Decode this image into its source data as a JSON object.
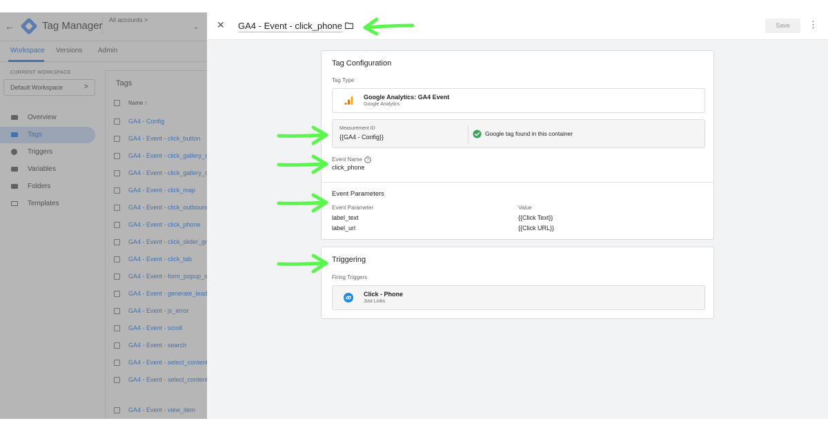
{
  "background_app": {
    "back_icon": "arrow-left-icon",
    "app_name": "Tag Manager",
    "accounts_label": "All accounts >",
    "accounts_caret": "⌄",
    "tabs": [
      "Workspace",
      "Versions",
      "Admin"
    ],
    "current_workspace_label": "CURRENT WORKSPACE",
    "workspace_name": "Default Workspace",
    "workspace_chevron": ">",
    "nav": [
      {
        "label": "Overview",
        "icon": "overview-icon",
        "active": false
      },
      {
        "label": "Tags",
        "icon": "tag-icon",
        "active": true
      },
      {
        "label": "Triggers",
        "icon": "trigger-icon",
        "active": false
      },
      {
        "label": "Variables",
        "icon": "variables-icon",
        "active": false
      },
      {
        "label": "Folders",
        "icon": "folder-icon",
        "active": false
      },
      {
        "label": "Templates",
        "icon": "template-icon",
        "active": false
      }
    ],
    "tags_table": {
      "title": "Tags",
      "column_name": "Name ↑",
      "rows": [
        "GA4 - Config",
        "GA4 - Event - click_button",
        "GA4 - Event - click_gallery_c",
        "GA4 - Event - click_gallery_o",
        "GA4 - Event - click_map",
        "GA4 - Event - click_outbound",
        "GA4 - Event - click_phone",
        "GA4 - Event - click_slider_gri",
        "GA4 - Event - click_tab",
        "GA4 - Event - form_popup_s",
        "GA4 - Event - generate_lead",
        "GA4 - Event - js_error",
        "GA4 - Event - scroll",
        "GA4 - Event - search",
        "GA4 - Event - select_content",
        "GA4 - Event - select_content",
        "GA4 - Event - view_item"
      ]
    }
  },
  "panel": {
    "close_icon": "close-icon",
    "tag_name": "GA4 - Event - click_phone",
    "folder_icon": "folder-outline-icon",
    "save_label": "Save",
    "more_icon": "more-vert-icon",
    "more_glyph": "⋮",
    "close_glyph": "✕"
  },
  "tag_configuration": {
    "title": "Tag Configuration",
    "tag_type_label": "Tag Type",
    "tag_type_name": "Google Analytics: GA4 Event",
    "tag_type_vendor": "Google Analytics",
    "measurement_id_label": "Measurement ID",
    "measurement_id_value": "{{GA4 - Config}}",
    "google_tag_status": "Google tag found in this container",
    "event_name_label": "Event Name",
    "event_name_value": "click_phone",
    "event_parameters_title": "Event Parameters",
    "param_col_label": "Event Parameter",
    "value_col_label": "Value",
    "parameters": [
      {
        "name": "label_text",
        "value": "{{Click Text}}"
      },
      {
        "name": "label_url",
        "value": "{{Click URL}}"
      }
    ]
  },
  "triggering": {
    "title": "Triggering",
    "firing_triggers_label": "Firing Triggers",
    "trigger_name": "Click - Phone",
    "trigger_type": "Just Links"
  },
  "colors": {
    "accent_blue": "#1a73e8",
    "annotation_green": "#5cf54e",
    "success_green": "#34a853",
    "ga_orange": "#f9ab00",
    "ga_dark_orange": "#e37400"
  }
}
